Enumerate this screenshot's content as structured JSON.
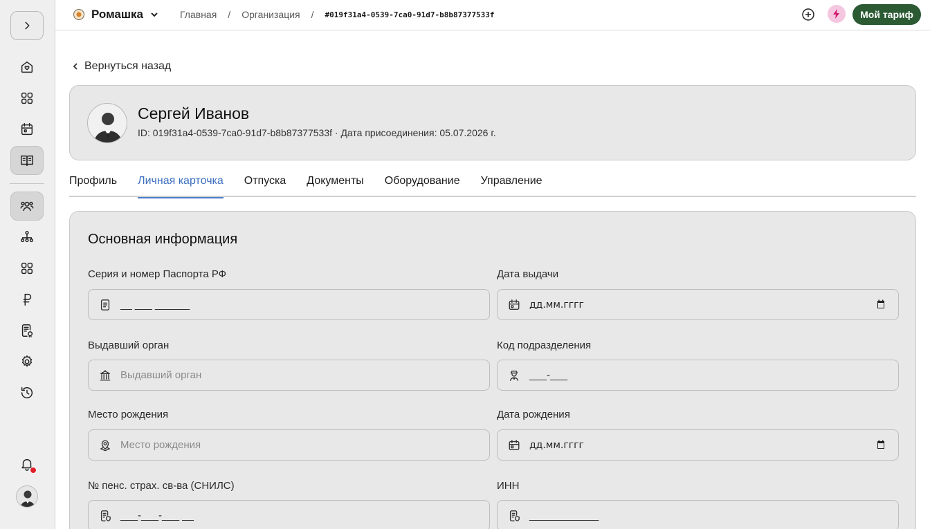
{
  "org": {
    "name": "Ромашка"
  },
  "breadcrumbs": {
    "home": "Главная",
    "org": "Организация",
    "sep": "/",
    "id": "#019f31a4-0539-7ca0-91d7-b8b87377533f"
  },
  "topbar": {
    "plan_label": "Мой тариф"
  },
  "back_label": "Вернуться назад",
  "profile": {
    "name": "Сергей Иванов",
    "meta": "ID: 019f31a4-0539-7ca0-91d7-b8b87377533f · Дата присоединения: 05.07.2026 г."
  },
  "tabs": [
    "Профиль",
    "Личная карточка",
    "Отпуска",
    "Документы",
    "Оборудование",
    "Управление"
  ],
  "section": {
    "title": "Основная информация",
    "fields": {
      "passport": {
        "label": "Серия и номер Паспорта РФ",
        "value": "__ ___ ______"
      },
      "issue_date": {
        "label": "Дата выдачи",
        "value": "дд.мм.гггг"
      },
      "issuer": {
        "label": "Выдавший орган",
        "placeholder": "Выдавший орган"
      },
      "division_code": {
        "label": "Код подразделения",
        "value": "___-___"
      },
      "birth_place": {
        "label": "Место рождения",
        "placeholder": "Место рождения"
      },
      "birth_date": {
        "label": "Дата рождения",
        "value": "дд.мм.гггг"
      },
      "snils": {
        "label": "№ пенс. страх. св-ва (СНИЛС)",
        "value": "___-___-___ __"
      },
      "inn": {
        "label": "ИНН",
        "value": "____________"
      }
    }
  },
  "colors": {
    "accent": "#2b5a33",
    "tab_active": "#3c6fbf",
    "bolt_bg": "#f5c6e0",
    "notif": "#e0202a"
  }
}
